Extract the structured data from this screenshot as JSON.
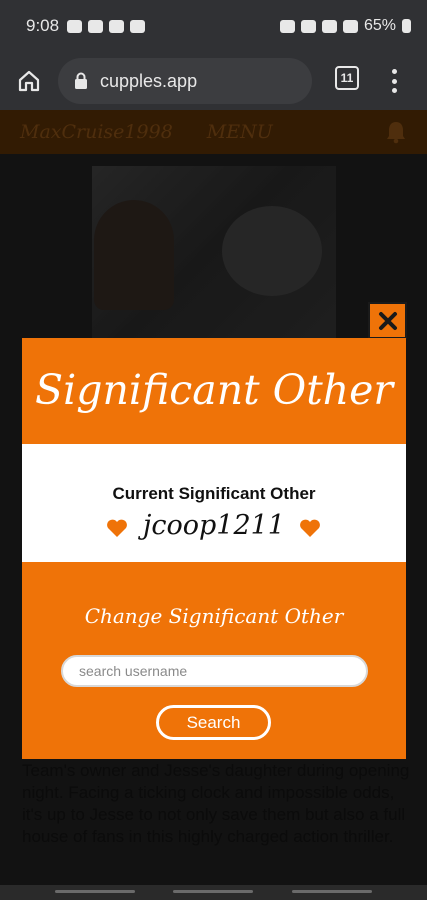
{
  "status_bar": {
    "time": "9:08",
    "battery": "65%"
  },
  "browser": {
    "url": "cupples.app",
    "tab_count": "11"
  },
  "site_header": {
    "username": "MaxCruise1998",
    "menu_label": "MENU"
  },
  "background_text": "Team's owner and Jesse's daughter during opening night. Facing a ticking clock and impossible odds, it's up to Jesse to not only save them but also a full house of fans in this highly charged action thriller.",
  "modal": {
    "title": "Significant Other",
    "current_label": "Current Significant Other",
    "current_name": "jcoop1211",
    "change_label": "Change Significant Other",
    "search_placeholder": "search username",
    "search_value": "",
    "search_button": "Search"
  },
  "colors": {
    "accent": "#ef7308",
    "panel": "#ffffff",
    "dim_header": "#4d2a05"
  },
  "icons": [
    "home-icon",
    "lock-icon",
    "tabs-icon",
    "more-vert-icon",
    "bell-icon",
    "close-icon",
    "heart-icon"
  ]
}
